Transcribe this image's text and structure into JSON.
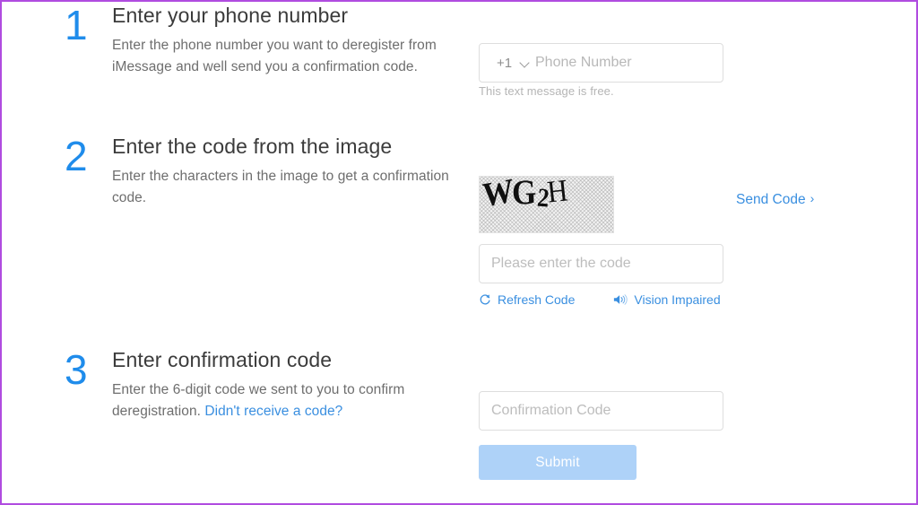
{
  "page": {
    "border_color": "#b04ce0",
    "accent_blue": "#1f8ceb",
    "link_blue": "#3a8fe0",
    "submit_disabled_color": "#aed2f8"
  },
  "steps": [
    {
      "number": "1",
      "title": "Enter your phone number",
      "description": "Enter the phone number you want to deregister from iMessage and well send you a confirmation code."
    },
    {
      "number": "2",
      "title": "Enter the code from the image",
      "description": "Enter the characters in the image to get a confirmation code."
    },
    {
      "number": "3",
      "title": "Enter confirmation code",
      "description_before_link": "Enter the 6-digit code we sent to you to confirm deregistration. ",
      "link_label": "Didn't receive a code?"
    }
  ],
  "phone": {
    "country_code": "+1",
    "placeholder": "Phone Number",
    "value": "",
    "helper_text": "This text message is free.",
    "dropdown_icon": "chevron-down-icon"
  },
  "captcha": {
    "characters": [
      "W",
      "G",
      "2",
      "H"
    ],
    "text": "WG2H",
    "input_placeholder": "Please enter the code",
    "input_value": "",
    "send_code_label": "Send Code",
    "send_code_chevron": "›",
    "refresh_label": "Refresh Code",
    "refresh_icon": "refresh-icon",
    "vision_label": "Vision Impaired",
    "vision_icon": "speaker-icon"
  },
  "confirmation": {
    "placeholder": "Confirmation Code",
    "value": "",
    "submit_label": "Submit"
  }
}
